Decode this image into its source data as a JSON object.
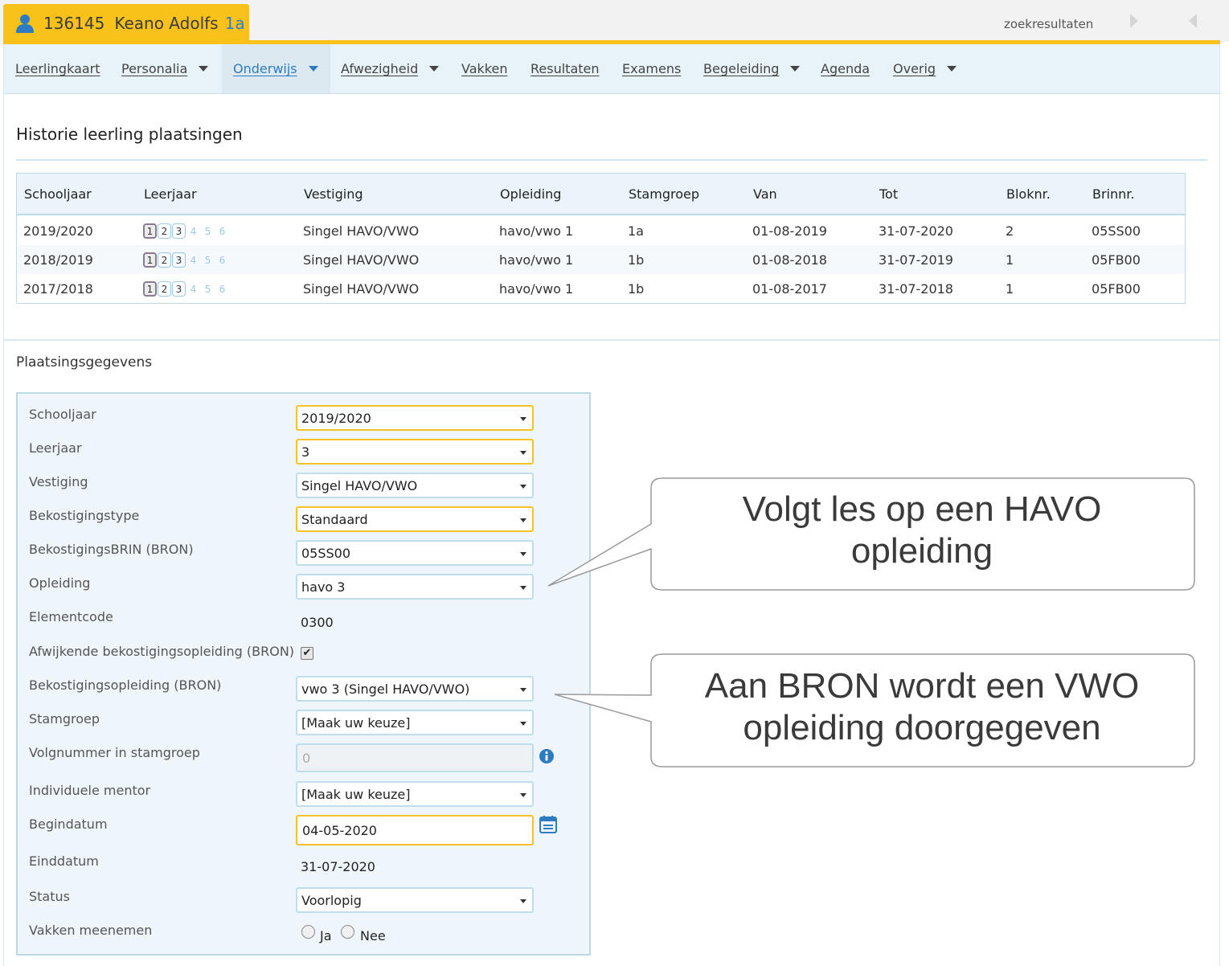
{
  "header": {
    "student_number": "136145",
    "student_name": "Keano Adolfs",
    "student_class": "1a",
    "search_results_label": "zoekresultaten"
  },
  "menu": {
    "items": [
      {
        "label": "Leerlingkaart"
      },
      {
        "label": "Personalia"
      },
      {
        "label": "Onderwijs"
      },
      {
        "label": "Afwezigheid"
      },
      {
        "label": "Vakken"
      },
      {
        "label": "Resultaten"
      },
      {
        "label": "Examens"
      },
      {
        "label": "Begeleiding"
      },
      {
        "label": "Agenda"
      },
      {
        "label": "Overig"
      }
    ]
  },
  "history": {
    "title": "Historie leerling plaatsingen",
    "columns": [
      "Schooljaar",
      "Leerjaar",
      "Vestiging",
      "Opleiding",
      "Stamgroep",
      "Van",
      "Tot",
      "Bloknr.",
      "Brinnr."
    ],
    "rows": [
      {
        "schooljaar": "2019/2020",
        "vestiging": "Singel HAVO/VWO",
        "opleiding": "havo/vwo 1",
        "stamgroep": "1a",
        "van": "01-08-2019",
        "tot": "31-07-2020",
        "bloknr": "2",
        "brinnr": "05SS00"
      },
      {
        "schooljaar": "2018/2019",
        "vestiging": "Singel HAVO/VWO",
        "opleiding": "havo/vwo 1",
        "stamgroep": "1b",
        "van": "01-08-2018",
        "tot": "31-07-2019",
        "bloknr": "1",
        "brinnr": "05FB00"
      },
      {
        "schooljaar": "2017/2018",
        "vestiging": "Singel HAVO/VWO",
        "opleiding": "havo/vwo 1",
        "stamgroep": "1b",
        "van": "01-08-2017",
        "tot": "31-07-2018",
        "bloknr": "1",
        "brinnr": "05FB00"
      }
    ],
    "leerjaar_steps": [
      "1",
      "2",
      "3",
      "4",
      "5",
      "6"
    ]
  },
  "form": {
    "title": "Plaatsingsgegevens",
    "labels": {
      "schooljaar": "Schooljaar",
      "leerjaar": "Leerjaar",
      "vestiging": "Vestiging",
      "bekostigingstype": "Bekostigingstype",
      "bekostigingsbrin": "BekostigingsBRIN (BRON)",
      "opleiding": "Opleiding",
      "elementcode": "Elementcode",
      "afwijkende": "Afwijkende bekostigingsopleiding (BRON)",
      "bekostigingsopleiding": "Bekostigingsopleiding (BRON)",
      "stamgroep": "Stamgroep",
      "volgnummer": "Volgnummer in stamgroep",
      "mentor": "Individuele mentor",
      "begindatum": "Begindatum",
      "einddatum": "Einddatum",
      "status": "Status",
      "vakken": "Vakken meenemen"
    },
    "values": {
      "schooljaar": "2019/2020",
      "leerjaar": "3",
      "vestiging": "Singel HAVO/VWO",
      "bekostigingstype": "Standaard",
      "bekostigingsbrin": "05SS00",
      "opleiding": "havo 3",
      "elementcode": "0300",
      "afwijkende_checked": "✔",
      "bekostigingsopleiding": "vwo 3 (Singel HAVO/VWO)",
      "stamgroep": "[Maak uw keuze]",
      "volgnummer": "0",
      "mentor": "[Maak uw keuze]",
      "begindatum": "04-05-2020",
      "einddatum": "31-07-2020",
      "status": "Voorlopig",
      "vakken_ja": "Ja",
      "vakken_nee": "Nee"
    }
  },
  "callouts": {
    "first_line1": "Volgt les op een HAVO",
    "first_line2": "opleiding",
    "second_line1": "Aan BRON wordt een VWO",
    "second_line2": "opleiding doorgegeven"
  },
  "colors": {
    "accent_yellow": "#f9c21b",
    "accent_blue": "#2d7bc0",
    "panel_bg": "#eff6fb"
  }
}
